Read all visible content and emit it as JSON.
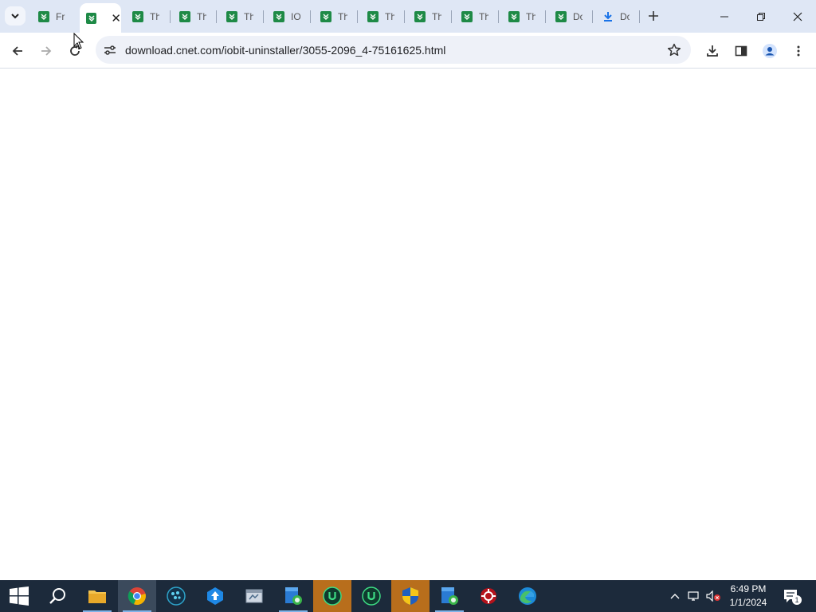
{
  "browser": {
    "tabs": [
      {
        "label": "Fr",
        "favicon": "cnet-icon"
      },
      {
        "label": "",
        "favicon": "cnet-icon",
        "active": true
      },
      {
        "label": "Th",
        "favicon": "cnet-icon"
      },
      {
        "label": "Th",
        "favicon": "cnet-icon"
      },
      {
        "label": "Th",
        "favicon": "cnet-icon"
      },
      {
        "label": "IO",
        "favicon": "cnet-icon"
      },
      {
        "label": "Th",
        "favicon": "cnet-icon"
      },
      {
        "label": "Th",
        "favicon": "cnet-icon"
      },
      {
        "label": "Th",
        "favicon": "cnet-icon"
      },
      {
        "label": "Th",
        "favicon": "cnet-icon"
      },
      {
        "label": "Th",
        "favicon": "cnet-icon"
      },
      {
        "label": "Do",
        "favicon": "cnet-icon"
      },
      {
        "label": "Do",
        "favicon": "download-icon"
      }
    ],
    "url": "download.cnet.com/iobit-uninstaller/3055-2096_4-75161625.html",
    "favicon_color": "#1e8a46",
    "tabstrip_color": "#dfe7f5"
  },
  "taskbar": {
    "time": "6:49 PM",
    "date": "1/1/2024",
    "notification_count": "1",
    "color": "#1c2a3b"
  }
}
